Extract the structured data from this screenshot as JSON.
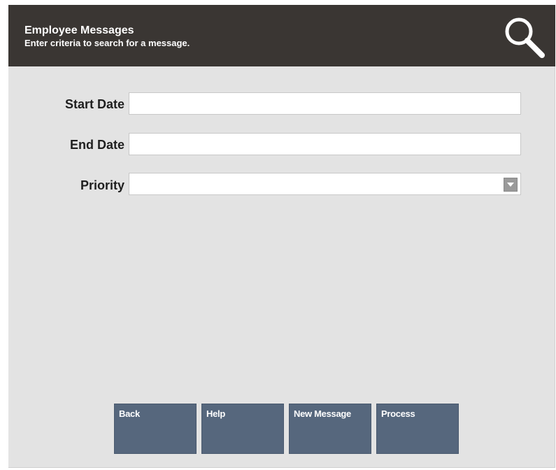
{
  "header": {
    "title": "Employee Messages",
    "subtitle": "Enter criteria to search for a message.",
    "icon": "search-icon"
  },
  "form": {
    "start_date": {
      "label": "Start Date",
      "value": ""
    },
    "end_date": {
      "label": "End Date",
      "value": ""
    },
    "priority": {
      "label": "Priority",
      "value": ""
    }
  },
  "buttons": {
    "back": "Back",
    "help": "Help",
    "new_message": "New Message",
    "process": "Process"
  },
  "colors": {
    "header_bg": "#3a3633",
    "panel_bg": "#e3e3e3",
    "button_bg": "#56677d"
  }
}
